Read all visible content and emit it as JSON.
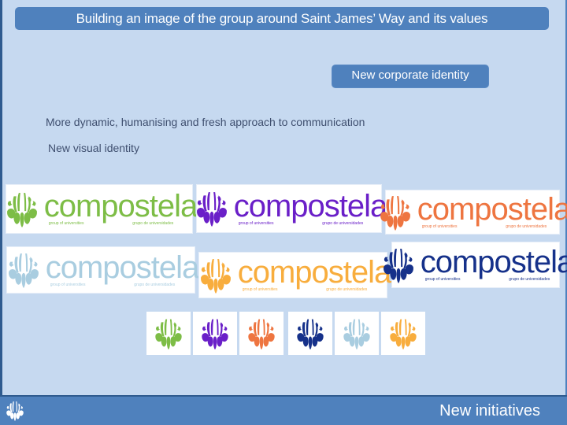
{
  "slide": {
    "title": "Building an image of the group around Saint James’ Way and its values",
    "badge_label": "New corporate identity",
    "bullets": [
      "More dynamic, humanising and fresh approach to communication",
      "New visual identity"
    ],
    "footer_title": "New initiatives"
  },
  "logos": [
    {
      "name": "compostela",
      "tag_en": "group of universities",
      "tag_es": "grupo de universidades",
      "color": "#7dbd46",
      "variant": "green"
    },
    {
      "name": "compostela",
      "tag_en": "group of universities",
      "tag_es": "grupo de universidades",
      "color": "#6a1fc8",
      "variant": "purple"
    },
    {
      "name": "compostela",
      "tag_en": "group of universities",
      "tag_es": "grupo de universidades",
      "color": "#ee7540",
      "variant": "orange"
    },
    {
      "name": "compostela",
      "tag_en": "group of universities",
      "tag_es": "grupo de universidades",
      "color": "#a9cde0",
      "variant": "light-blue"
    },
    {
      "name": "compostela",
      "tag_en": "group of universities",
      "tag_es": "grupo de universidades",
      "color": "#f8ad3d",
      "variant": "gold"
    },
    {
      "name": "compostela",
      "tag_en": "group of universities",
      "tag_es": "grupo de universidades",
      "color": "#16318a",
      "variant": "navy"
    }
  ],
  "shell_icons": [
    {
      "variant": "green",
      "color": "#7dbd46"
    },
    {
      "variant": "purple",
      "color": "#6a1fc8"
    },
    {
      "variant": "orange",
      "color": "#ee7540"
    },
    {
      "variant": "navy",
      "color": "#16318a"
    },
    {
      "variant": "light-blue",
      "color": "#a9cde0"
    },
    {
      "variant": "gold",
      "color": "#f8ad3d"
    }
  ],
  "colors": {
    "background": "#c6d9f0",
    "accent": "#4f81bd",
    "text": "#3f4f6f"
  }
}
